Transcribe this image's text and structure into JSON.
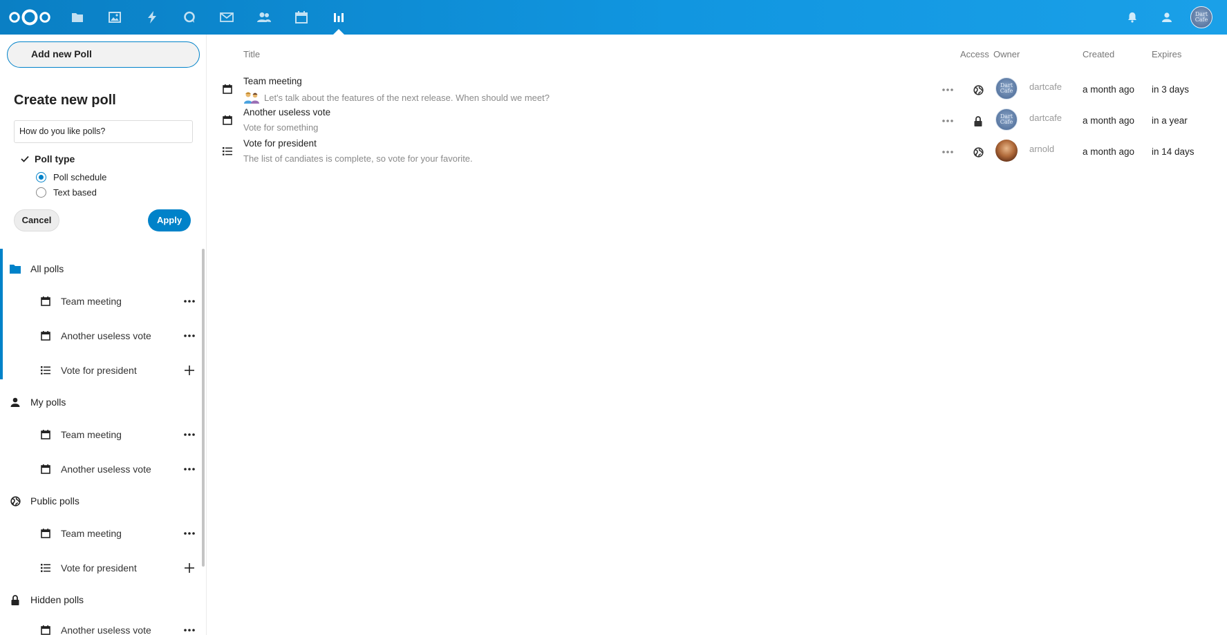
{
  "header": {
    "apps": [
      "files",
      "photos",
      "activity",
      "talk",
      "mail",
      "contacts",
      "calendar",
      "polls"
    ],
    "active_app": "polls",
    "avatar_text": "Dart Cafe",
    "colors": {
      "primary": "#0082c9",
      "header_start": "#0a7fc4",
      "header_end": "#1aa0e8"
    }
  },
  "sidebar": {
    "add_button": "Add new Poll",
    "create": {
      "title": "Create new poll",
      "input_value": "How do you like polls?",
      "poll_type_label": "Poll type",
      "options": [
        "Poll schedule",
        "Text based"
      ],
      "selected": "Poll schedule",
      "cancel": "Cancel",
      "apply": "Apply"
    },
    "groups": [
      {
        "label": "All polls",
        "icon": "folder-icon",
        "items": [
          {
            "label": "Team meeting",
            "icon": "calendar-icon",
            "action": "more"
          },
          {
            "label": "Another useless vote",
            "icon": "calendar-icon",
            "action": "more"
          },
          {
            "label": "Vote for president",
            "icon": "text-list-icon",
            "action": "add"
          }
        ]
      },
      {
        "label": "My polls",
        "icon": "user-icon",
        "items": [
          {
            "label": "Team meeting",
            "icon": "calendar-icon",
            "action": "more"
          },
          {
            "label": "Another useless vote",
            "icon": "calendar-icon",
            "action": "more"
          }
        ]
      },
      {
        "label": "Public polls",
        "icon": "globe-icon",
        "items": [
          {
            "label": "Team meeting",
            "icon": "calendar-icon",
            "action": "more"
          },
          {
            "label": "Vote for president",
            "icon": "text-list-icon",
            "action": "add"
          }
        ]
      },
      {
        "label": "Hidden polls",
        "icon": "lock-icon",
        "items": [
          {
            "label": "Another useless vote",
            "icon": "calendar-icon",
            "action": "more"
          }
        ]
      }
    ]
  },
  "table": {
    "headers": {
      "title": "Title",
      "access": "Access",
      "owner": "Owner",
      "created": "Created",
      "expires": "Expires"
    },
    "rows": [
      {
        "type": "calendar-icon",
        "title": "Team meeting",
        "description": "Let's talk about the features of the next release. When should we meet?",
        "access": "public",
        "owner": "dartcafe",
        "created": "a month ago",
        "expires": "in 3 days"
      },
      {
        "type": "calendar-icon",
        "title": "Another useless vote",
        "description": "Vote for something",
        "access": "hidden",
        "owner": "dartcafe",
        "created": "a month ago",
        "expires": "in a year"
      },
      {
        "type": "text-list-icon",
        "title": "Vote for president",
        "description": "The list of candiates is complete, so vote for your favorite.",
        "access": "public",
        "owner": "arnold",
        "created": "a month ago",
        "expires": "in 14 days"
      }
    ]
  }
}
